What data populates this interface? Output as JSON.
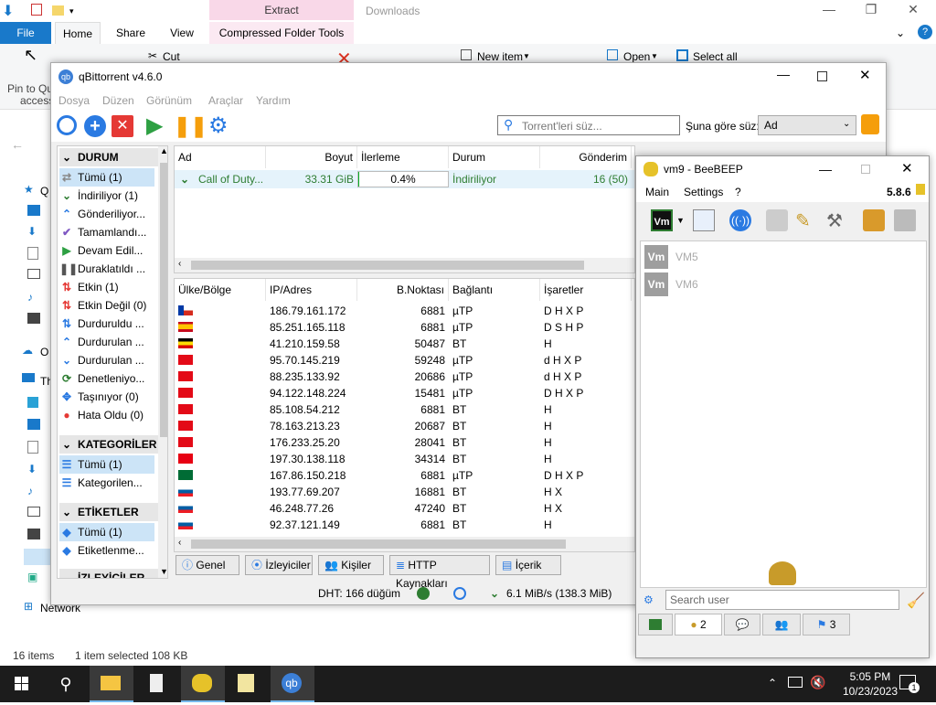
{
  "explorer": {
    "context_tab": "Extract",
    "window_title": "Downloads",
    "tabs": [
      "File",
      "Home",
      "Share",
      "View",
      "Compressed Folder Tools"
    ],
    "ribbon": {
      "cut": "Cut",
      "new_item": "New item",
      "open": "Open",
      "select_all": "Select all",
      "pin": "Pin to Qu",
      "access": "access"
    },
    "network": "Network",
    "status_items": "16 items",
    "status_selected": "1 item selected  108 KB",
    "nav_labels": [
      "Q",
      "O",
      "Th"
    ]
  },
  "qbt": {
    "title": "qBittorrent v4.6.0",
    "menu": [
      "Dosya",
      "Düzen",
      "Görünüm",
      "Araçlar",
      "Yardım"
    ],
    "search_placeholder": "Torrent'leri süz...",
    "filter_label": "Şuna göre süz:",
    "filter_value": "Ad",
    "sidebar": {
      "status_title": "DURUM",
      "status_items": [
        "Tümü (1)",
        "İndiriliyor (1)",
        "Gönderiliyor...",
        "Tamamlandı...",
        "Devam Edil...",
        "Duraklatıldı ...",
        "Etkin (1)",
        "Etkin Değil (0)",
        "Durduruldu ...",
        "Durdurulan ...",
        "Durdurulan ...",
        "Denetleniyo...",
        "Taşınıyor (0)",
        "Hata Oldu (0)"
      ],
      "categories_title": "KATEGORİLER",
      "category_items": [
        "Tümü (1)",
        "Kategorilen..."
      ],
      "tags_title": "ETİKETLER",
      "tag_items": [
        "Tümü (1)",
        "Etiketlenme..."
      ],
      "trackers_title": "İZLEYİCİLER"
    },
    "torrent_headers": [
      "Ad",
      "Boyut",
      "İlerleme",
      "Durum",
      "Gönderim"
    ],
    "torrent": {
      "name": "Call of Duty...",
      "size": "33.31 GiB",
      "progress": "0.4%",
      "progress_value": 0.004,
      "status": "İndiriliyor",
      "seeds": "16 (50)"
    },
    "peer_headers": [
      "Ülke/Bölge",
      "IP/Adres",
      "B.Noktası",
      "Bağlantı",
      "İşaretler"
    ],
    "peers": [
      {
        "flag": "cl",
        "ip": "186.79.161.172",
        "port": "6881",
        "conn": "µTP",
        "flags": "D H X P"
      },
      {
        "flag": "es",
        "ip": "85.251.165.118",
        "port": "6881",
        "conn": "µTP",
        "flags": "D S H P"
      },
      {
        "flag": "ug",
        "ip": "41.210.159.58",
        "port": "50487",
        "conn": "BT",
        "flags": "H"
      },
      {
        "flag": "tr",
        "ip": "95.70.145.219",
        "port": "59248",
        "conn": "µTP",
        "flags": "d H X P"
      },
      {
        "flag": "tr",
        "ip": "88.235.133.92",
        "port": "20686",
        "conn": "µTP",
        "flags": "d H X P"
      },
      {
        "flag": "tr",
        "ip": "94.122.148.224",
        "port": "15481",
        "conn": "µTP",
        "flags": "D H X P"
      },
      {
        "flag": "tr",
        "ip": "85.108.54.212",
        "port": "6881",
        "conn": "BT",
        "flags": "H"
      },
      {
        "flag": "tr",
        "ip": "78.163.213.23",
        "port": "20687",
        "conn": "BT",
        "flags": "H"
      },
      {
        "flag": "tr",
        "ip": "176.233.25.20",
        "port": "28041",
        "conn": "BT",
        "flags": "H"
      },
      {
        "flag": "tn",
        "ip": "197.30.138.118",
        "port": "34314",
        "conn": "BT",
        "flags": "H"
      },
      {
        "flag": "sa",
        "ip": "167.86.150.218",
        "port": "6881",
        "conn": "µTP",
        "flags": "D H X P"
      },
      {
        "flag": "si",
        "ip": "193.77.69.207",
        "port": "16881",
        "conn": "BT",
        "flags": "H X"
      },
      {
        "flag": "si",
        "ip": "46.248.77.26",
        "port": "47240",
        "conn": "BT",
        "flags": "H X"
      },
      {
        "flag": "si",
        "ip": "92.37.121.149",
        "port": "6881",
        "conn": "BT",
        "flags": "H"
      }
    ],
    "bottom_tabs": [
      "Genel",
      "İzleyiciler",
      "Kişiler",
      "HTTP Kaynakları",
      "İçerik"
    ],
    "status": {
      "dht": "DHT: 166 düğüm",
      "speed": "6.1 MiB/s (138.3 MiB)"
    }
  },
  "bee": {
    "title": "vm9 - BeeBEEP",
    "menu": [
      "Main",
      "Settings",
      "?"
    ],
    "version": "5.8.6",
    "users": [
      "VM5",
      "VM6"
    ],
    "badge": "Vm",
    "search_placeholder": "Search user",
    "tabs": [
      "",
      "2",
      "",
      "",
      "3"
    ]
  },
  "taskbar": {
    "time": "5:05 PM",
    "date": "10/23/2023",
    "notif": "1",
    "qb": "qb"
  },
  "colors": {
    "accent": "#1979ca",
    "green": "#2e7d32",
    "taskbar": "#1c1c1c",
    "context_tab": "#f9d8e8"
  }
}
